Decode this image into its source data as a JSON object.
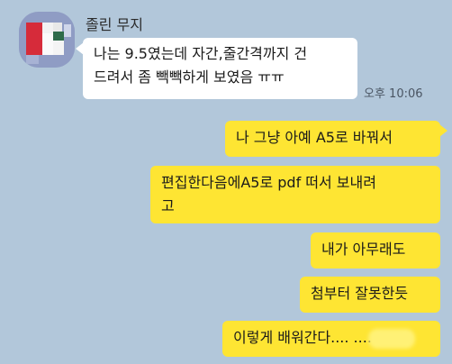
{
  "chat": {
    "sender_name": "졸린 무지",
    "incoming": {
      "line1": "나는 9.5였는데 자간,줄간격까지 건",
      "line2": "드려서 좀 빽빽하게 보였음 ㅠㅠ",
      "time": "오후 10:06"
    },
    "outgoing": [
      {
        "text": "나 그냥 아예 A5로 바꿔서"
      },
      {
        "line1": "편집한다음에A5로 pdf 떠서 보내려",
        "line2": "고"
      },
      {
        "text": "내가 아무래도"
      },
      {
        "text": "첨부터 잘못한듯"
      },
      {
        "text": "이렇게 배워간다....            ...."
      }
    ]
  },
  "colors": {
    "background": "#b2c7da",
    "incoming_bubble": "#ffffff",
    "outgoing_bubble": "#fee533"
  },
  "icons": {
    "avatar": "profile-avatar"
  }
}
